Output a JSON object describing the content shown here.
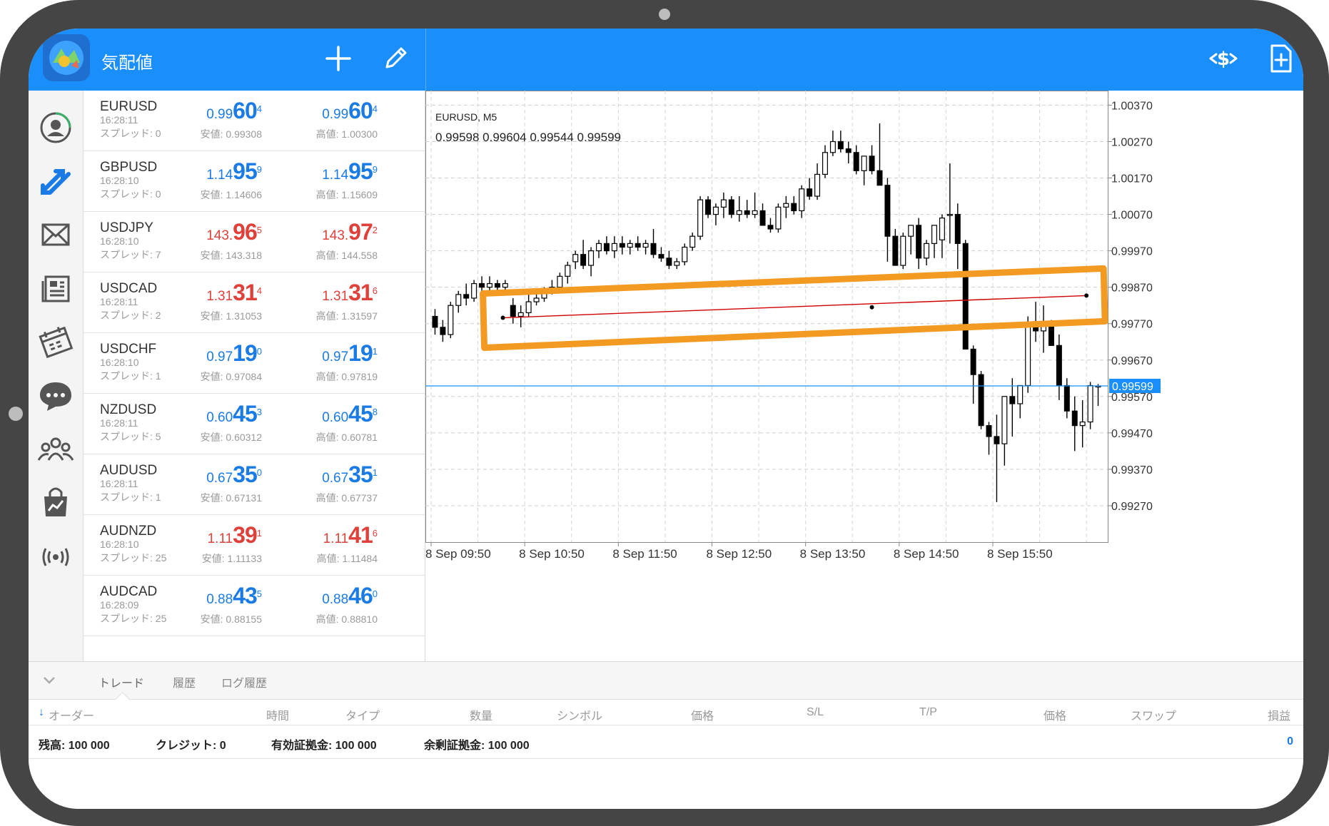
{
  "header": {
    "title": "気配値"
  },
  "quotes": [
    {
      "symbol": "EURUSD",
      "time": "16:28:11",
      "spread": "スプレッド: 0",
      "bid": {
        "pre": "0.99",
        "big": "60",
        "sup": "4",
        "color": "blue"
      },
      "ask": {
        "pre": "0.99",
        "big": "60",
        "sup": "4",
        "color": "blue"
      },
      "low": "安値: 0.99308",
      "high": "高値: 1.00300"
    },
    {
      "symbol": "GBPUSD",
      "time": "16:28:10",
      "spread": "スプレッド: 0",
      "bid": {
        "pre": "1.14",
        "big": "95",
        "sup": "9",
        "color": "blue"
      },
      "ask": {
        "pre": "1.14",
        "big": "95",
        "sup": "9",
        "color": "blue"
      },
      "low": "安値: 1.14606",
      "high": "高値: 1.15609"
    },
    {
      "symbol": "USDJPY",
      "time": "16:28:10",
      "spread": "スプレッド: 7",
      "bid": {
        "pre": "143.",
        "big": "96",
        "sup": "5",
        "color": "red"
      },
      "ask": {
        "pre": "143.",
        "big": "97",
        "sup": "2",
        "color": "red"
      },
      "low": "安値: 143.318",
      "high": "高値: 144.558"
    },
    {
      "symbol": "USDCAD",
      "time": "16:28:11",
      "spread": "スプレッド: 2",
      "bid": {
        "pre": "1.31",
        "big": "31",
        "sup": "4",
        "color": "red"
      },
      "ask": {
        "pre": "1.31",
        "big": "31",
        "sup": "6",
        "color": "red"
      },
      "low": "安値: 1.31053",
      "high": "高値: 1.31597"
    },
    {
      "symbol": "USDCHF",
      "time": "16:28:10",
      "spread": "スプレッド: 1",
      "bid": {
        "pre": "0.97",
        "big": "19",
        "sup": "0",
        "color": "blue"
      },
      "ask": {
        "pre": "0.97",
        "big": "19",
        "sup": "1",
        "color": "blue"
      },
      "low": "安値: 0.97084",
      "high": "高値: 0.97819"
    },
    {
      "symbol": "NZDUSD",
      "time": "16:28:11",
      "spread": "スプレッド: 5",
      "bid": {
        "pre": "0.60",
        "big": "45",
        "sup": "3",
        "color": "blue"
      },
      "ask": {
        "pre": "0.60",
        "big": "45",
        "sup": "8",
        "color": "blue"
      },
      "low": "安値: 0.60312",
      "high": "高値: 0.60781"
    },
    {
      "symbol": "AUDUSD",
      "time": "16:28:11",
      "spread": "スプレッド: 1",
      "bid": {
        "pre": "0.67",
        "big": "35",
        "sup": "0",
        "color": "blue"
      },
      "ask": {
        "pre": "0.67",
        "big": "35",
        "sup": "1",
        "color": "blue"
      },
      "low": "安値: 0.67131",
      "high": "高値: 0.67737"
    },
    {
      "symbol": "AUDNZD",
      "time": "16:28:10",
      "spread": "スプレッド: 25",
      "bid": {
        "pre": "1.11",
        "big": "39",
        "sup": "1",
        "color": "red"
      },
      "ask": {
        "pre": "1.11",
        "big": "41",
        "sup": "6",
        "color": "red"
      },
      "low": "安値: 1.11133",
      "high": "高値: 1.11484"
    },
    {
      "symbol": "AUDCAD",
      "time": "16:28:09",
      "spread": "スプレッド: 25",
      "bid": {
        "pre": "0.88",
        "big": "43",
        "sup": "5",
        "color": "blue"
      },
      "ask": {
        "pre": "0.88",
        "big": "46",
        "sup": "0",
        "color": "blue"
      },
      "low": "安値: 0.88155",
      "high": "高値: 0.88810"
    }
  ],
  "sidebar": {
    "icons": [
      "account-icon",
      "trade-arrows-icon",
      "mail-icon",
      "news-icon",
      "calendar-icon",
      "chat-icon",
      "community-icon",
      "market-icon",
      "signals-icon"
    ]
  },
  "chart": {
    "symbol_label": "EURUSD, M5",
    "ohlc_label": "0.99598 0.99604 0.99544 0.99599",
    "current_price": "0.99599",
    "colors": {
      "bid_line": "#1a8ffb",
      "trendline": "#d00000",
      "highlight": "#f39a22"
    }
  },
  "chart_data": {
    "type": "candlestick",
    "title": "EURUSD, M5",
    "y_ticks": [
      "1.00370",
      "1.00270",
      "1.00170",
      "1.00070",
      "0.99970",
      "0.99870",
      "0.99770",
      "0.99670",
      "0.99570",
      "0.99470",
      "0.99370",
      "0.99270"
    ],
    "x_ticks": [
      "8 Sep 09:50",
      "8 Sep 10:50",
      "8 Sep 11:50",
      "8 Sep 12:50",
      "8 Sep 13:50",
      "8 Sep 14:50",
      "8 Sep 15:50"
    ],
    "ylim": [
      0.9917,
      1.0041
    ],
    "bid": 0.99599,
    "trendline": {
      "start": [
        9.2,
        0.99786
      ],
      "mid": [
        56.5,
        0.99815
      ],
      "end": [
        84.0,
        0.99847
      ]
    },
    "candles": [
      [
        0.9979,
        0.9981,
        0.9974,
        0.9976
      ],
      [
        0.9976,
        0.9978,
        0.9972,
        0.9974
      ],
      [
        0.9974,
        0.9983,
        0.9973,
        0.9982
      ],
      [
        0.9982,
        0.9986,
        0.998,
        0.9985
      ],
      [
        0.9985,
        0.9988,
        0.9982,
        0.9984
      ],
      [
        0.9984,
        0.9989,
        0.9983,
        0.9988
      ],
      [
        0.9988,
        0.999,
        0.9985,
        0.9987
      ],
      [
        0.9987,
        0.999,
        0.9986,
        0.9988
      ],
      [
        0.9988,
        0.9989,
        0.9986,
        0.9987
      ],
      [
        0.9987,
        0.9989,
        0.9986,
        0.9988
      ],
      [
        0.9982,
        0.9984,
        0.9977,
        0.9979
      ],
      [
        0.9979,
        0.9982,
        0.9976,
        0.998
      ],
      [
        0.998,
        0.9985,
        0.9979,
        0.9983
      ],
      [
        0.9983,
        0.9986,
        0.9982,
        0.9984
      ],
      [
        0.9984,
        0.9987,
        0.9983,
        0.9986
      ],
      [
        0.9986,
        0.9989,
        0.9985,
        0.9987
      ],
      [
        0.9987,
        0.9991,
        0.9986,
        0.999
      ],
      [
        0.999,
        0.9994,
        0.9988,
        0.9993
      ],
      [
        0.9994,
        0.9997,
        0.9992,
        0.9996
      ],
      [
        0.9996,
        1.0,
        0.9992,
        0.9993
      ],
      [
        0.9993,
        0.9998,
        0.999,
        0.9997
      ],
      [
        0.9997,
        1.0,
        0.9995,
        0.9999
      ],
      [
        0.9999,
        1.0001,
        0.9996,
        0.9997
      ],
      [
        0.9997,
        1.0001,
        0.9995,
        0.9999
      ],
      [
        0.9999,
        1.0001,
        0.9996,
        0.9998
      ],
      [
        0.9998,
        1.0,
        0.9996,
        0.9999
      ],
      [
        0.9999,
        1.0001,
        0.9997,
        0.9998
      ],
      [
        0.9998,
        1.0,
        0.9996,
        0.9999
      ],
      [
        0.9999,
        1.0003,
        0.9995,
        0.9996
      ],
      [
        0.9996,
        0.9998,
        0.9994,
        0.9995
      ],
      [
        0.9995,
        0.9997,
        0.9992,
        0.9993
      ],
      [
        0.9993,
        0.9995,
        0.9992,
        0.9994
      ],
      [
        0.9994,
        0.9999,
        0.9993,
        0.9998
      ],
      [
        0.9998,
        1.0002,
        0.9997,
        1.0001
      ],
      [
        1.0001,
        1.0012,
        1.0,
        1.0011
      ],
      [
        1.0011,
        1.0012,
        1.0006,
        1.0007
      ],
      [
        1.0007,
        1.001,
        1.0004,
        1.0009
      ],
      [
        1.0009,
        1.0013,
        1.0006,
        1.0011
      ],
      [
        1.0011,
        1.0012,
        1.0006,
        1.0007
      ],
      [
        1.0007,
        1.0012,
        1.0005,
        1.0008
      ],
      [
        1.0008,
        1.0011,
        1.0006,
        1.0007
      ],
      [
        1.0007,
        1.0013,
        1.0006,
        1.0008
      ],
      [
        1.0008,
        1.001,
        1.0004,
        1.0004
      ],
      [
        1.0004,
        1.0006,
        1.0002,
        1.0003
      ],
      [
        1.0003,
        1.001,
        1.0002,
        1.0009
      ],
      [
        1.0009,
        1.0012,
        1.0006,
        1.001
      ],
      [
        1.001,
        1.0012,
        1.0007,
        1.0008
      ],
      [
        1.0008,
        1.0015,
        1.0006,
        1.0014
      ],
      [
        1.0014,
        1.0017,
        1.0011,
        1.0012
      ],
      [
        1.0012,
        1.0021,
        1.0011,
        1.0018
      ],
      [
        1.0018,
        1.0026,
        1.0017,
        1.0024
      ],
      [
        1.0024,
        1.003,
        1.0023,
        1.0027
      ],
      [
        1.0027,
        1.003,
        1.0024,
        1.0025
      ],
      [
        1.0025,
        1.0027,
        1.0021,
        1.0024
      ],
      [
        1.0024,
        1.0026,
        1.0018,
        1.0019
      ],
      [
        1.0019,
        1.0023,
        1.0015,
        1.0023
      ],
      [
        1.0023,
        1.0026,
        1.0018,
        1.0019
      ],
      [
        1.0019,
        1.0032,
        1.0016,
        1.0015
      ],
      [
        1.0015,
        1.0017,
        0.9994,
        1.0001
      ],
      [
        1.0001,
        1.0003,
        0.9993,
        0.9993
      ],
      [
        0.9993,
        1.0002,
        0.9992,
        1.0001
      ],
      [
        1.0001,
        1.0004,
        0.9996,
        1.0004
      ],
      [
        1.0004,
        1.0006,
        0.9992,
        0.9995
      ],
      [
        0.9995,
        1.0,
        0.9993,
        0.9999
      ],
      [
        0.9999,
        1.0003,
        0.9995,
        1.0004
      ],
      [
        1.0,
        1.0007,
        0.9995,
        1.0006
      ],
      [
        1.0007,
        1.0021,
        0.9999,
        1.0007
      ],
      [
        1.0007,
        1.001,
        0.9992,
        0.9999
      ],
      [
        0.9999,
        1.0,
        0.999,
        0.997
      ],
      [
        0.997,
        0.9971,
        0.9955,
        0.9963
      ],
      [
        0.9963,
        0.9964,
        0.9948,
        0.9949
      ],
      [
        0.9949,
        0.995,
        0.9941,
        0.9946
      ],
      [
        0.9946,
        0.9952,
        0.9928,
        0.9944
      ],
      [
        0.9944,
        0.9952,
        0.9938,
        0.9957
      ],
      [
        0.9957,
        0.9962,
        0.9946,
        0.9955
      ],
      [
        0.9955,
        0.996,
        0.9951,
        0.996
      ],
      [
        0.996,
        0.9979,
        0.9958,
        0.9977
      ],
      [
        0.9977,
        0.9983,
        0.9972,
        0.9975
      ],
      [
        0.9975,
        0.9982,
        0.9969,
        0.9977
      ],
      [
        0.9977,
        0.9978,
        0.9972,
        0.9971
      ],
      [
        0.9971,
        0.9974,
        0.9956,
        0.996
      ],
      [
        0.996,
        0.9962,
        0.9951,
        0.9953
      ],
      [
        0.9953,
        0.9957,
        0.9942,
        0.9949
      ],
      [
        0.9949,
        0.9956,
        0.9943,
        0.995
      ],
      [
        0.995,
        0.9961,
        0.9948,
        0.996
      ],
      [
        0.99598,
        0.99604,
        0.99544,
        0.99599
      ]
    ]
  },
  "bottom": {
    "tabs": [
      "トレード",
      "履歴",
      "ログ履歴"
    ],
    "columns": [
      "オーダー",
      "時間",
      "タイプ",
      "数量",
      "シンボル",
      "価格",
      "S/L",
      "T/P",
      "価格",
      "スワップ",
      "損益"
    ],
    "balance": "残高:  100 000",
    "credit": "クレジット:  0",
    "equity": "有効証拠金:  100 000",
    "free_margin": "余剰証拠金:  100 000",
    "profit": "0"
  }
}
